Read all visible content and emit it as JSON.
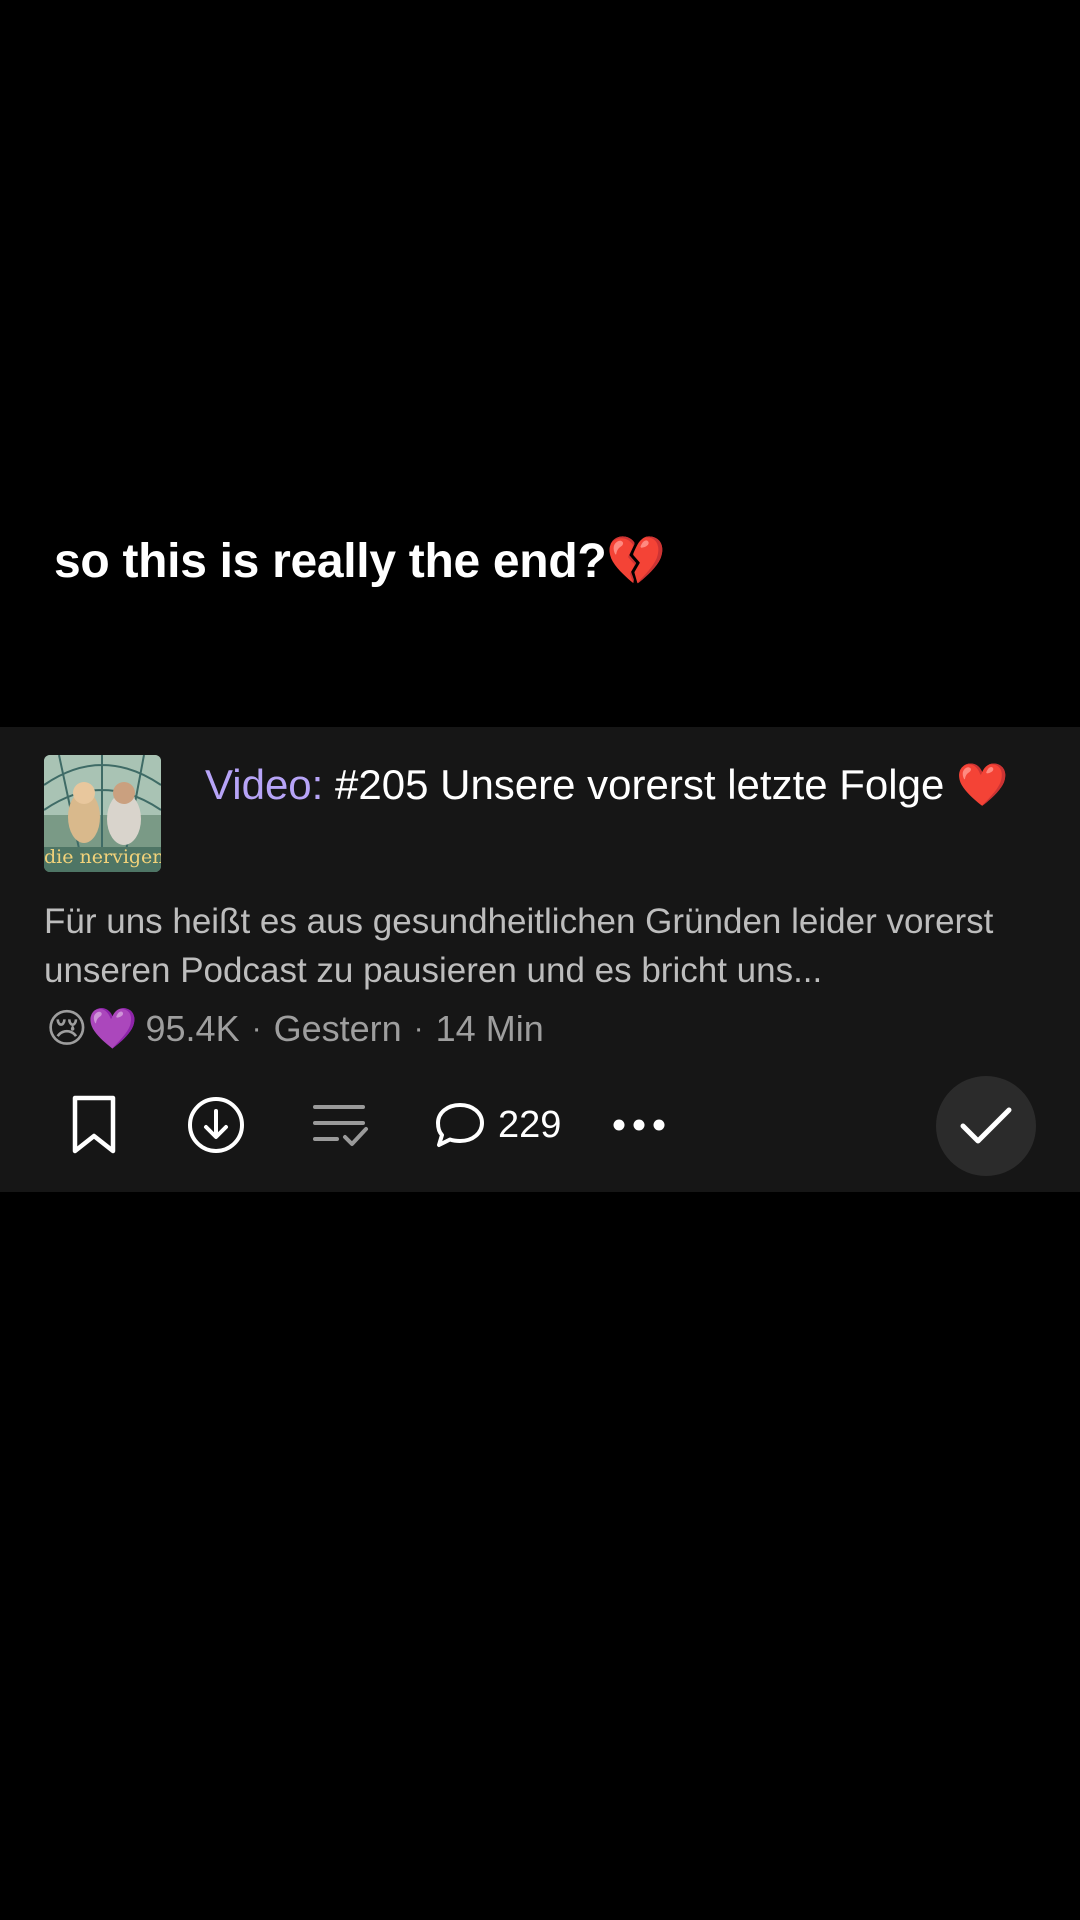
{
  "overlay": {
    "caption": "so this is really the end?💔"
  },
  "episode": {
    "thumbnail_text": "die nervigen",
    "title_prefix": "Video:",
    "title": "#205 Unsere vorerst letzte Folge ❤️",
    "description": "Für uns heißt es aus gesundheitlichen Gründen leider vorerst unseren Podcast zu pausieren und es bricht uns...",
    "reaction_emoji": "😢💜",
    "reactions": "95.4K",
    "date": "Gestern",
    "duration": "14 Min",
    "separator": "·"
  },
  "actions": {
    "save_icon": "bookmark-icon",
    "download_icon": "download-icon",
    "queue_icon": "add-to-queue-icon",
    "comment_icon": "comment-icon",
    "comment_count": "229",
    "more_icon": "more-options-icon",
    "played_icon": "checkmark-icon"
  },
  "colors": {
    "background": "#000000",
    "card": "#161616",
    "accent": "#b7a4f7",
    "played_button": "#2b2b2b"
  }
}
